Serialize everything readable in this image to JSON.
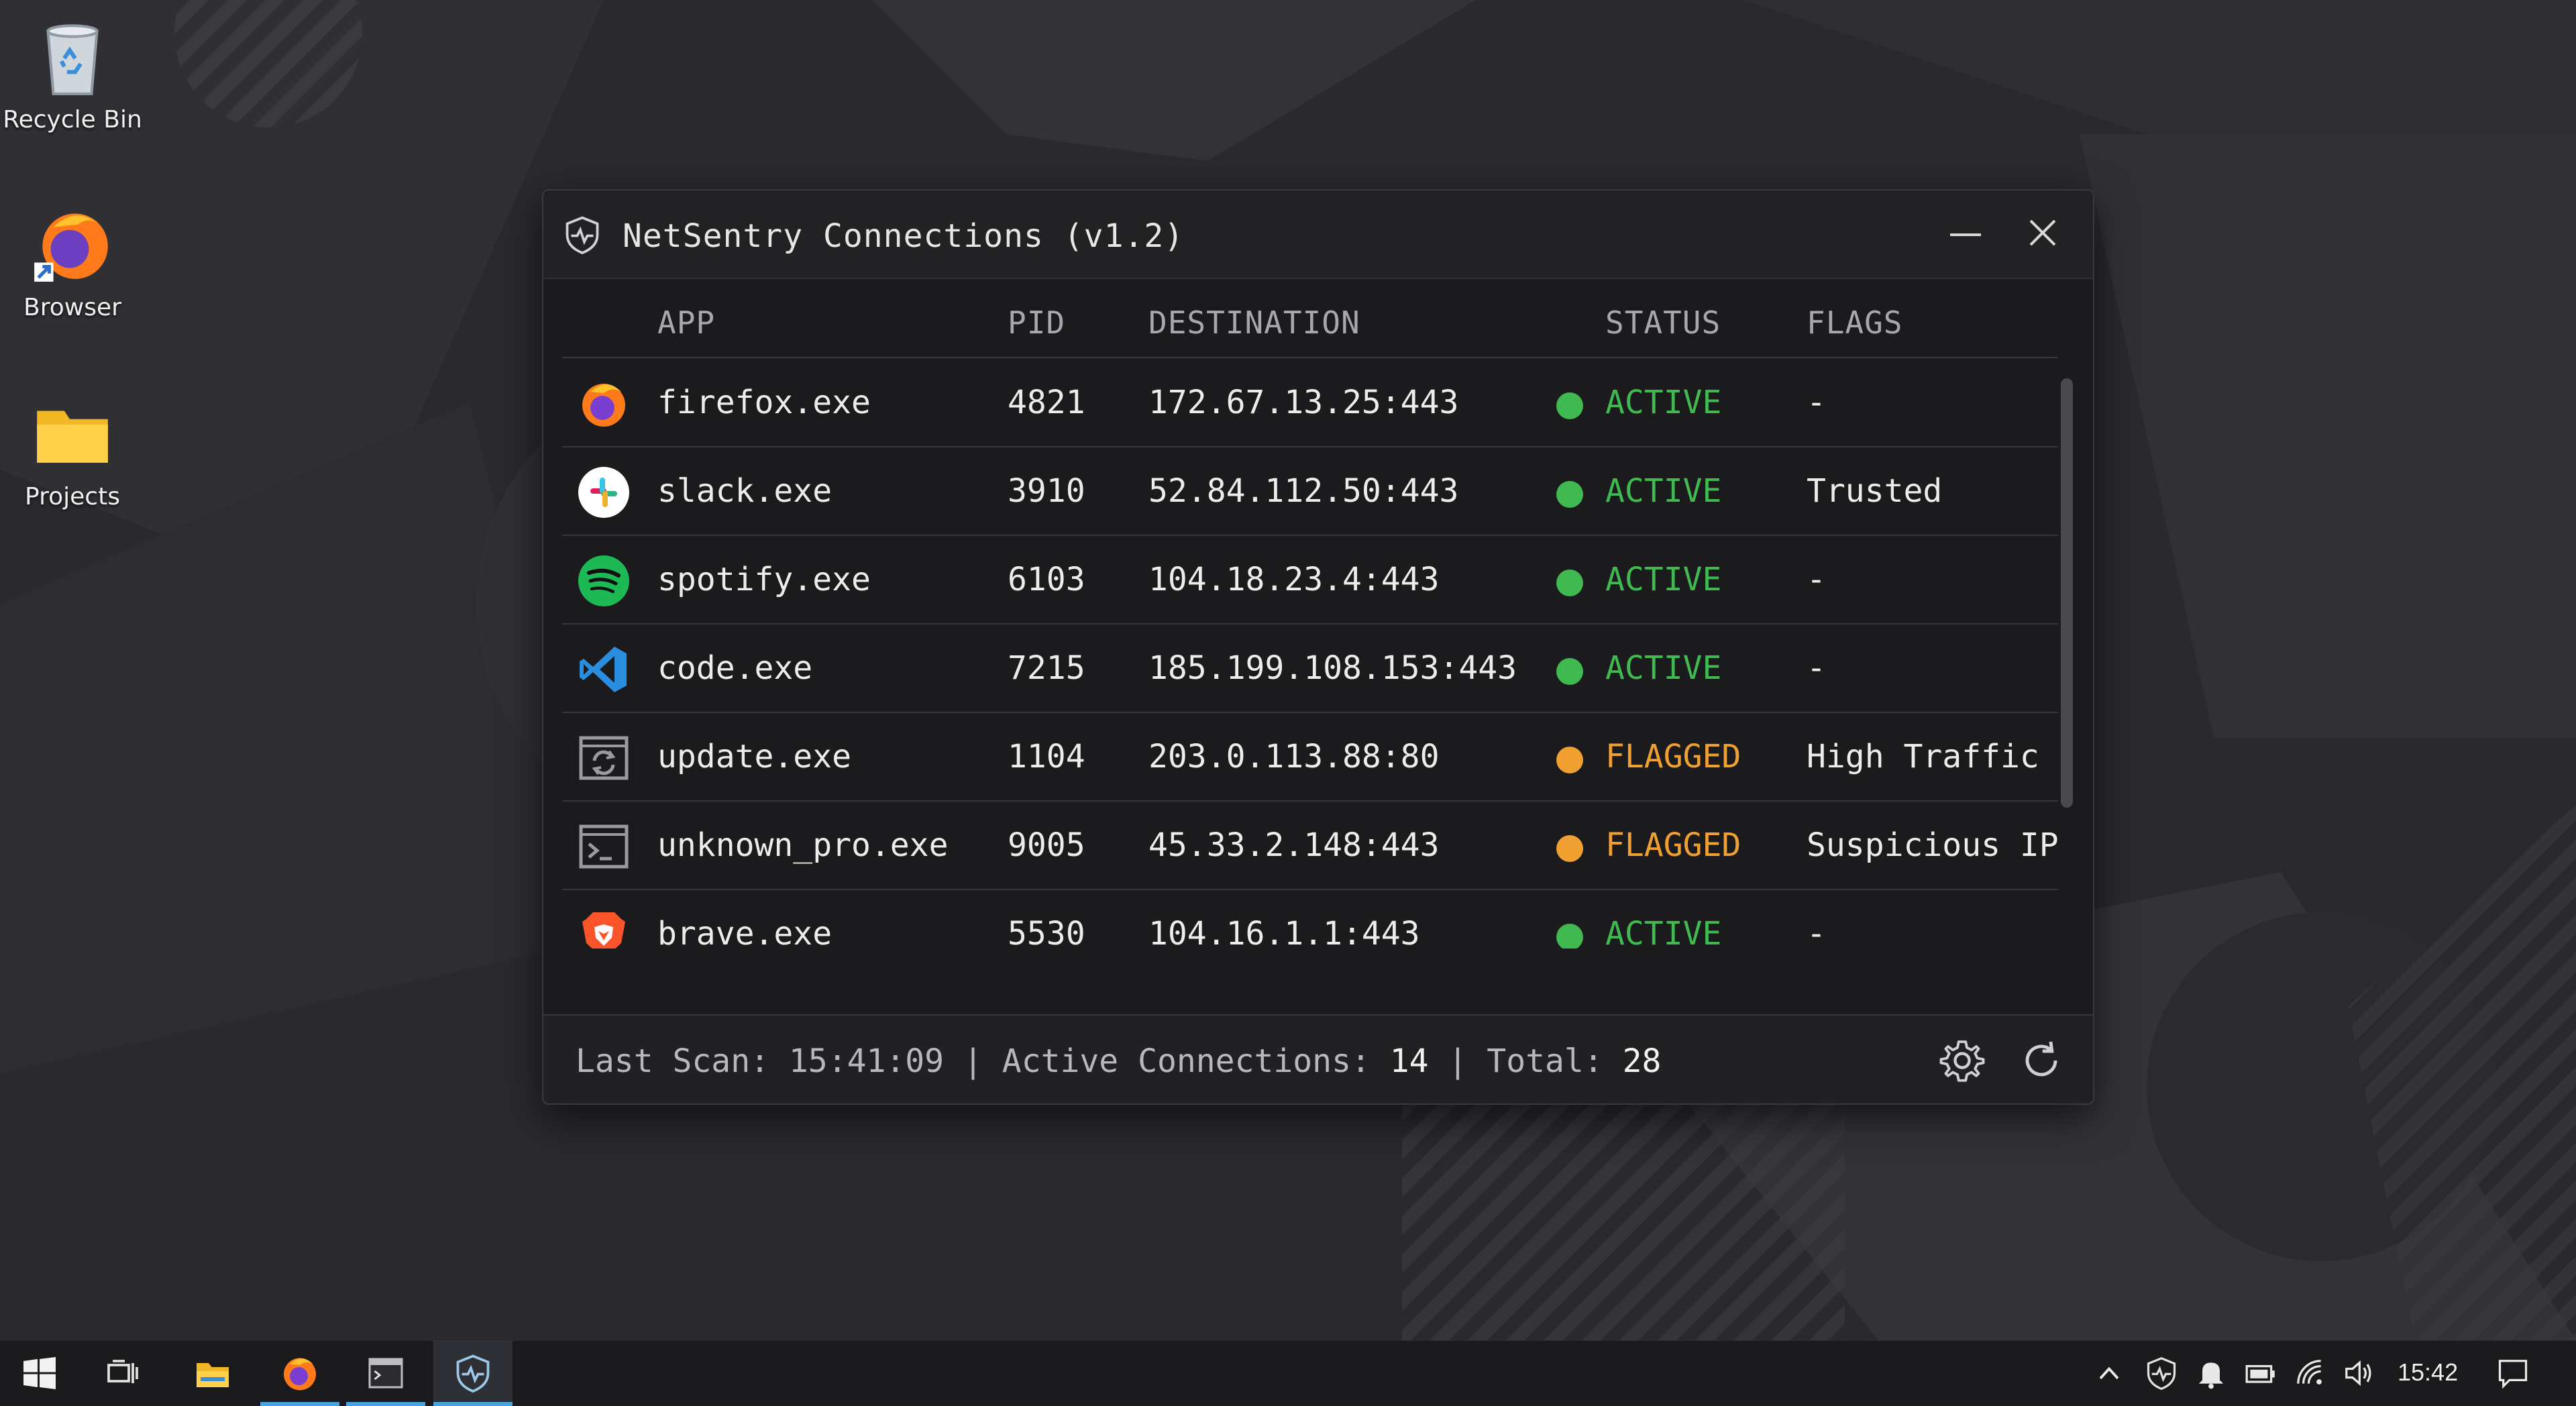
{
  "desktop": {
    "icons": [
      {
        "label": "Recycle Bin",
        "icon": "recycle-bin-icon"
      },
      {
        "label": "Browser",
        "icon": "firefox-icon"
      },
      {
        "label": "Projects",
        "icon": "folder-icon"
      }
    ]
  },
  "window": {
    "title": "NetSentry Connections (v1.2)",
    "icon": "shield-pulse-icon",
    "controls": [
      "minimize-icon",
      "close-icon"
    ]
  },
  "table": {
    "columns": [
      "APP",
      "PID",
      "DESTINATION",
      "STATUS",
      "FLAGS"
    ],
    "rows": [
      {
        "icon": "firefox-icon",
        "app": "firefox.exe",
        "pid": "4821",
        "destination": "172.67.13.25:443",
        "status": "ACTIVE",
        "flags": "-"
      },
      {
        "icon": "slack-icon",
        "app": "slack.exe",
        "pid": "3910",
        "destination": "52.84.112.50:443",
        "status": "ACTIVE",
        "flags": "Trusted"
      },
      {
        "icon": "spotify-icon",
        "app": "spotify.exe",
        "pid": "6103",
        "destination": "104.18.23.4:443",
        "status": "ACTIVE",
        "flags": "-"
      },
      {
        "icon": "vscode-icon",
        "app": "code.exe",
        "pid": "7215",
        "destination": "185.199.108.153:443",
        "status": "ACTIVE",
        "flags": "-"
      },
      {
        "icon": "update-window-icon",
        "app": "update.exe",
        "pid": "1104",
        "destination": "203.0.113.88:80",
        "status": "FLAGGED",
        "flags": "High Traffic"
      },
      {
        "icon": "terminal-window-icon",
        "app": "unknown_pro.exe",
        "pid": "9005",
        "destination": "45.33.2.148:443",
        "status": "FLAGGED",
        "flags": "Suspicious IP"
      },
      {
        "icon": "brave-icon",
        "app": "brave.exe",
        "pid": "5530",
        "destination": "104.16.1.1:443",
        "status": "ACTIVE",
        "flags": "-"
      }
    ]
  },
  "statusbar": {
    "last_scan_label": "Last Scan:",
    "last_scan_value": "15:41:09",
    "sep": "|",
    "active_label": "Active Connections:",
    "active_value": "14",
    "total_label": "Total:",
    "total_value": "28"
  },
  "taskbar": {
    "apps": [
      "start-icon",
      "task-view-icon",
      "file-explorer-icon",
      "firefox-icon",
      "terminal-icon",
      "netsentry-icon"
    ],
    "tray": [
      "chevron-up-icon",
      "shield-icon",
      "bell-icon",
      "battery-icon",
      "wifi-icon",
      "volume-icon",
      "notification-icon"
    ],
    "clock": "15:42"
  },
  "colors": {
    "active": "#3fb950",
    "flagged": "#f0a030",
    "accent": "#4aa3df"
  }
}
